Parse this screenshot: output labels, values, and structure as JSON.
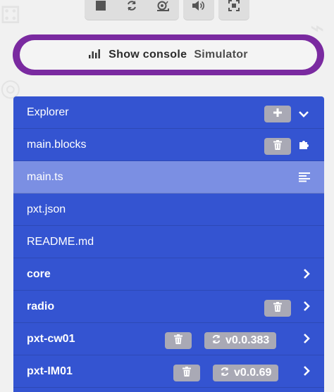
{
  "console": {
    "label": "Show console",
    "sublabel": "Simulator"
  },
  "toolbar": {
    "buttons": [
      "stop-icon",
      "restart-icon",
      "slow-motion-icon",
      "mute-icon",
      "fullscreen-icon"
    ]
  },
  "explorer": {
    "title": "Explorer",
    "files": [
      {
        "name": "main.blocks"
      },
      {
        "name": "main.ts"
      },
      {
        "name": "pxt.json"
      },
      {
        "name": "README.md"
      }
    ],
    "packages": [
      {
        "name": "core"
      },
      {
        "name": "radio"
      },
      {
        "name": "pxt-cw01",
        "version": "v0.0.383"
      },
      {
        "name": "pxt-IM01",
        "version": "v0.0.69"
      }
    ]
  },
  "colors": {
    "accent": "#7a2aa0",
    "explorer_bg": "#3454d1",
    "selected": "#7b8fe3",
    "pill": "#a9a9b5"
  }
}
